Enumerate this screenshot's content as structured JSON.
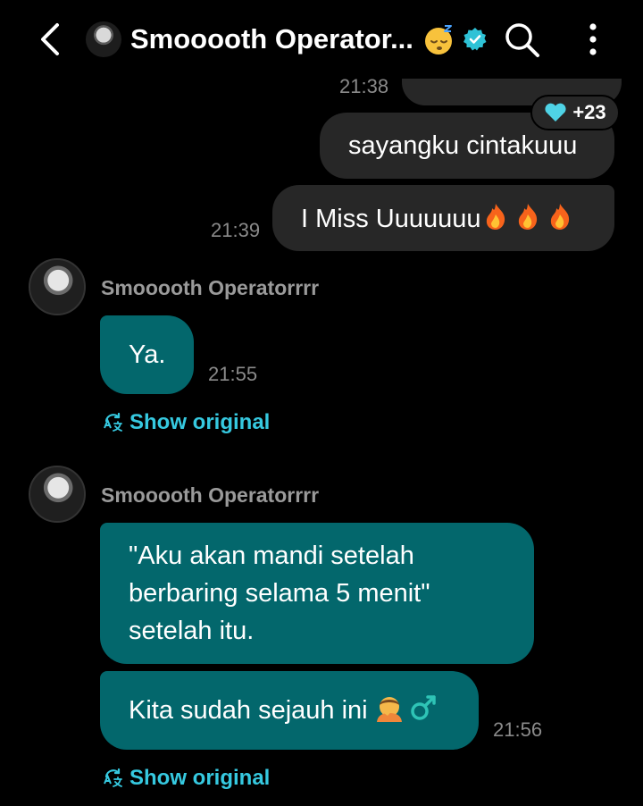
{
  "header": {
    "title": "Smooooth Operator...",
    "icons": [
      "back-icon",
      "sleeping-face-emoji",
      "verified-badge-icon",
      "search-icon",
      "more-vert-icon"
    ]
  },
  "messages_out": {
    "partial_time": "21:38",
    "reaction_count": "+23",
    "msg1": "sayangku cintakuuu",
    "msg2": "I Miss Uuuuuuu",
    "msg2_time": "21:39"
  },
  "messages_in": [
    {
      "sender": "Smooooth Operatorrrr",
      "text": "Ya.",
      "time": "21:55",
      "show_original": "Show original"
    },
    {
      "sender": "Smooooth Operatorrrr",
      "text": "\"Aku akan mandi setelah berbaring selama 5 menit\" setelah itu.",
      "text2": "Kita sudah sejauh ini",
      "time": "21:56",
      "show_original": "Show original"
    }
  ],
  "colors": {
    "incoming_bubble": "#03676c",
    "outgoing_bubble": "#272727",
    "accent": "#36c9e0"
  }
}
